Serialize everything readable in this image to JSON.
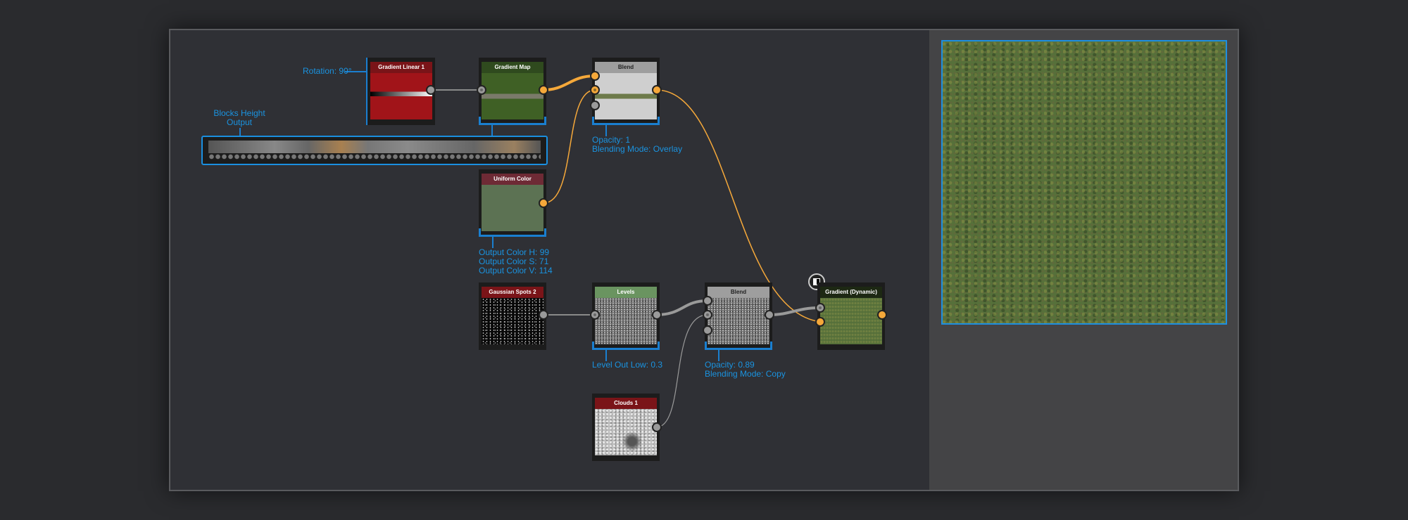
{
  "nodes": {
    "gradient_linear": {
      "title": "Gradient Linear 1",
      "param": "Rotation: 90°",
      "header_color": "#7a1418"
    },
    "gradient_map": {
      "title": "Gradient Map"
    },
    "blend_top": {
      "title": "Blend",
      "params": [
        "Opacity: 1",
        "Blending Mode: Overlay"
      ]
    },
    "uniform_color": {
      "title": "Uniform Color",
      "params": [
        "Output Color H: 99",
        "Output Color S: 71",
        "Output Color V: 114"
      ]
    },
    "gaussian_spots": {
      "title": "Gaussian Spots 2"
    },
    "levels": {
      "title": "Levels",
      "param": "Level Out Low: 0.3"
    },
    "blend_bottom": {
      "title": "Blend",
      "params": [
        "Opacity: 0.89",
        "Blending Mode: Copy"
      ]
    },
    "gradient_dynamic": {
      "title": "Gradient (Dynamic)"
    },
    "clouds": {
      "title": "Clouds 1"
    }
  },
  "gradient_editor": {
    "label_line1": "Blocks Height",
    "label_line2": "Output"
  },
  "colors": {
    "accent": "#1a93e0",
    "wire_color": "#f5a83a",
    "wire_grey": "#9a9a9a"
  }
}
